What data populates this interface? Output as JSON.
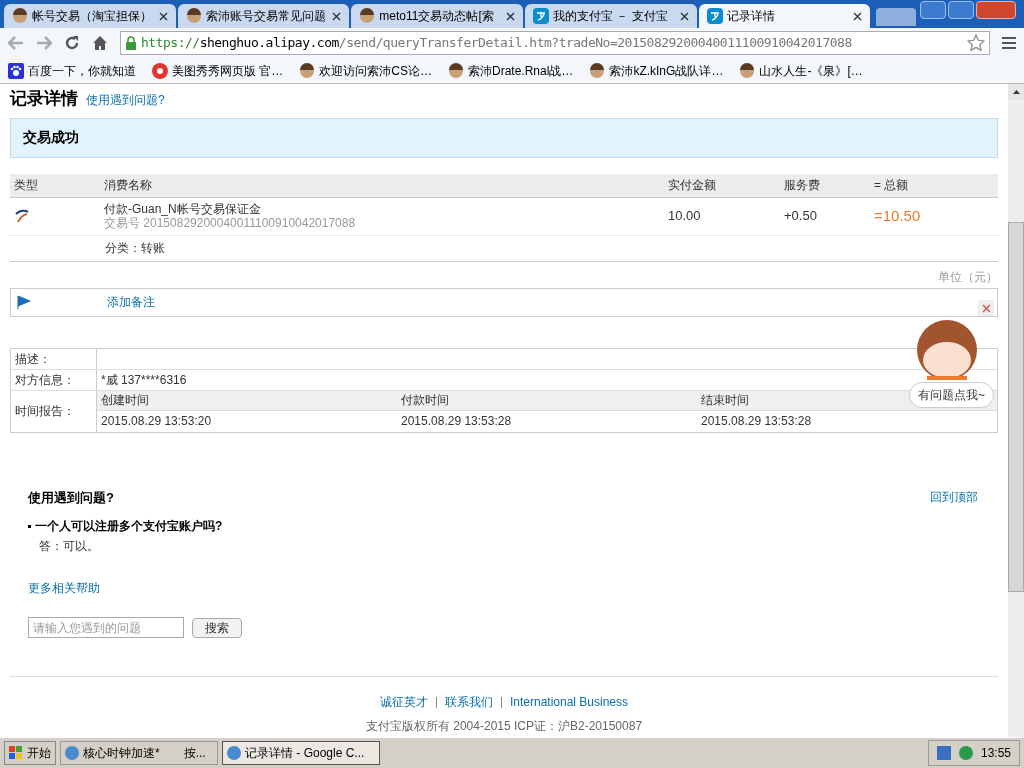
{
  "browser": {
    "tabs": [
      {
        "title": "帐号交易（淘宝担保）",
        "selected": false
      },
      {
        "title": "索沛账号交易常见问题",
        "selected": false
      },
      {
        "title": "meto11交易动态帖[索",
        "selected": false
      },
      {
        "title": "我的支付宝 － 支付宝",
        "selected": false
      },
      {
        "title": "记录详情",
        "selected": true
      }
    ],
    "url": {
      "scheme": "https://",
      "host": "shenghuo.alipay.com",
      "path": "/send/queryTransferDetail.htm?tradeNo=20150829200040011100910042017088"
    },
    "bookmarks": [
      {
        "title": "百度一下，你就知道"
      },
      {
        "title": "美图秀秀网页版 官…"
      },
      {
        "title": "欢迎访问索沛CS论…"
      },
      {
        "title": "索沛Drate.Rnal战…"
      },
      {
        "title": "索沛kZ.kInG战队详…"
      },
      {
        "title": "山水人生-《泉》[…"
      }
    ]
  },
  "page": {
    "title": "记录详情",
    "help_link": "使用遇到问题?",
    "status": "交易成功",
    "table": {
      "columns": [
        "类型",
        "消费名称",
        "实付金额",
        "服务费",
        "= 总额"
      ],
      "row": {
        "name": "付款-Guan_N帐号交易保证金",
        "trade_no": "交易号 20150829200040011100910042017088",
        "paid": "10.00",
        "fee": "+0.50",
        "total": "=10.50",
        "category": "分类：转账"
      }
    },
    "unit": "单位（元）",
    "add_note": "添加备注",
    "info": {
      "description_label": "描述：",
      "party_label": "对方信息：",
      "party": "*威 137****6316",
      "time_label": "时间报告：",
      "times": [
        {
          "label": "创建时间",
          "value": "2015.08.29 13:53:20"
        },
        {
          "label": "付款时间",
          "value": "2015.08.29 13:53:28"
        },
        {
          "label": "结束时间",
          "value": "2015.08.29 13:53:28"
        }
      ]
    },
    "assistant": {
      "bubble": "有问题点我~"
    },
    "help": {
      "title": "使用遇到问题?",
      "back_to_top": "回到顶部",
      "question": "一个人可以注册多个支付宝账户吗?",
      "answer": "答：可以。",
      "more": "更多相关帮助",
      "search_placeholder": "请输入您遇到的问题",
      "search_button": "搜索"
    },
    "footer": {
      "links": [
        "诚征英才",
        "联系我们",
        "International Business"
      ],
      "copyright": "支付宝版权所有 2004-2015 ICP证：沪B2-20150087"
    }
  },
  "taskbar": {
    "start": "开始",
    "tasks": [
      {
        "title": "核心时钟加速*　　按...",
        "selected": false
      },
      {
        "title": "记录详情 - Google C...",
        "selected": true
      }
    ],
    "clock": "13:55"
  }
}
